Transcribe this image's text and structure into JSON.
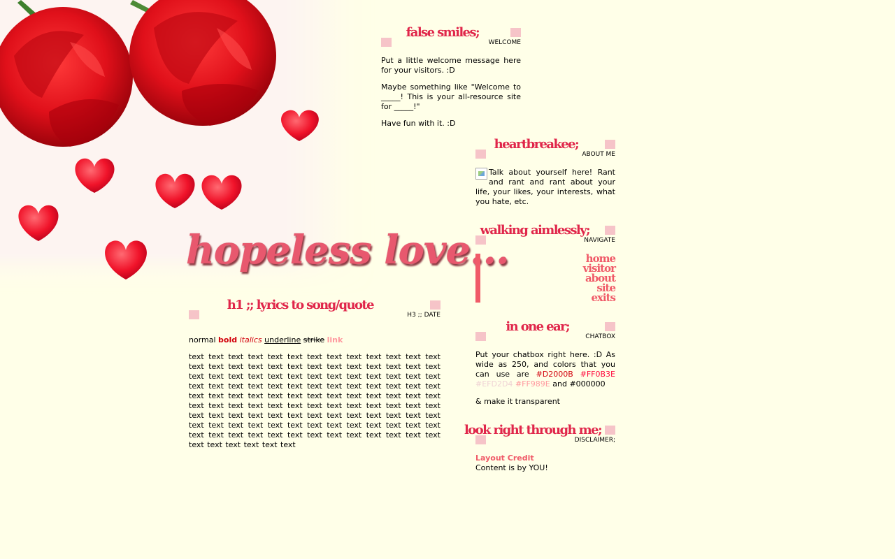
{
  "banner": {
    "title": "hopeless love..."
  },
  "welcome": {
    "title": "false smiles;",
    "subtitle": "WELCOME",
    "paragraphs": [
      "Put a little welcome message here for your visitors. :D",
      "Maybe something like \"Welcome to _____! This is your all-resource site for _____!\"",
      "Have fun with it. :D"
    ]
  },
  "post": {
    "title": "h1 ;; lyrics to song/quote",
    "subtitle": "H3 ;; DATE",
    "format": {
      "normal": "normal",
      "bold": "bold",
      "italics": "italics",
      "underline": "underline",
      "strike": "strike",
      "link": "link"
    },
    "body": "text text text text text text text text text text text text text text text text text text text text text text text text text text text text text text text text text text text text text text text text text text text text text text text text text text text text text text text text text text text text text text text text text text text text text text text text text text text text text text text text text text text text text text text text text text text text text text text text text text text text text text text text text text text text text text text text text text text text text text text text text text text"
  },
  "about": {
    "title": "heartbreakee;",
    "subtitle": "ABOUT ME",
    "text": "Talk about yourself here! Rant and rant and rant about your life, your likes, your interests, what you hate, etc."
  },
  "nav": {
    "title": "walking aimlessly;",
    "subtitle": "NAVIGATE",
    "links": [
      "home",
      "visitor",
      "about",
      "site",
      "exits"
    ]
  },
  "chat": {
    "title": "in one ear;",
    "subtitle": "CHATBOX",
    "intro": "Put your chatbox right here. :D As wide as 250, and colors that you can use are",
    "colors": [
      "#D2000B",
      "#FF0B3E",
      "#EFD2D4",
      "#FF989E",
      "#000000"
    ],
    "and_word": "and",
    "note": "& make it transparent"
  },
  "disclaimer": {
    "title": "look right through me;",
    "subtitle": "DISCLAIMER;",
    "credit_label": "Layout Credit",
    "content_note": "Content is by YOU!"
  }
}
